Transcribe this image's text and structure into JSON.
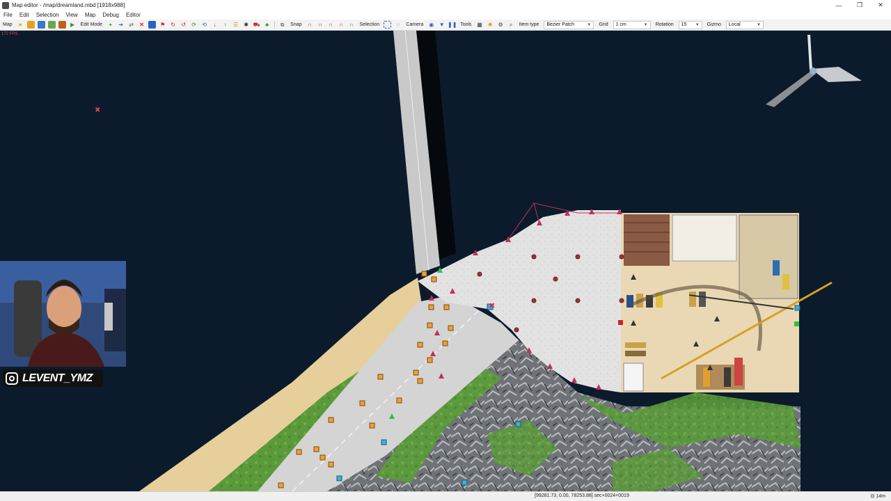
{
  "window": {
    "title": "Map editor - /map/dreamland.mbd [1918x988]",
    "controls": [
      "—",
      "❐",
      "✕"
    ]
  },
  "menu": [
    "File",
    "Edit",
    "Selection",
    "View",
    "Map",
    "Debug",
    "Editor"
  ],
  "toolbar": {
    "map_label": "Map",
    "edit_mode_label": "Edit Mode",
    "snap_label": "Snap",
    "selection_label": "Selection",
    "camera_label": "Camera",
    "tools_label": "Tools",
    "item_type_label": "Item type",
    "item_type_value": "Bezier Patch",
    "grid_label": "Grid",
    "grid_value": "1 cm",
    "rotation_label": "Rotation",
    "rotation_value": "15",
    "gizmo_label": "Gizmo",
    "gizmo_value": "Local"
  },
  "viewport": {
    "fps": "172 FPS",
    "background_color": "#0c1b2b"
  },
  "overlay": {
    "instagram_handle": "LEVENT_YMZ"
  },
  "status": {
    "coords": "[99281.73, 0.00, 78253.88] sec+0024+0019",
    "time": "14m"
  }
}
